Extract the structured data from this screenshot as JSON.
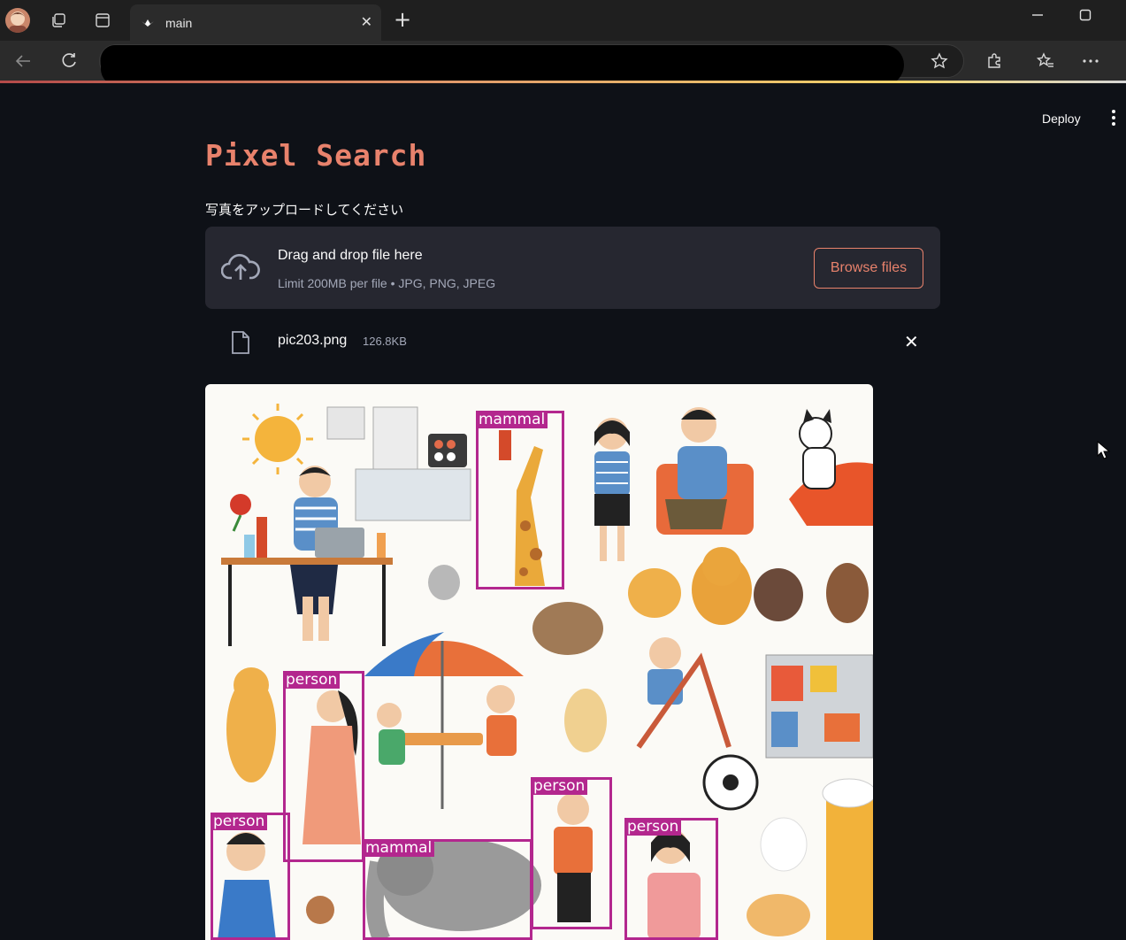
{
  "browser": {
    "tab_title": "main",
    "tab_close": "✕",
    "new_tab": "+"
  },
  "app": {
    "deploy_label": "Deploy",
    "title": "Pixel Search",
    "uploader_label": "写真をアップロードしてください",
    "dropzone_main": "Drag and drop file here",
    "dropzone_sub": "Limit 200MB per file • JPG, PNG, JPEG",
    "browse_label": "Browse files",
    "file_name": "pic203.png",
    "file_size": "126.8KB",
    "file_remove": "✕"
  },
  "detections": [
    {
      "label": "mammal"
    },
    {
      "label": "person"
    },
    {
      "label": "person"
    },
    {
      "label": "mammal"
    },
    {
      "label": "person"
    },
    {
      "label": "person"
    }
  ],
  "colors": {
    "accent": "#e8826c",
    "detection_box": "#b3278e",
    "background": "#0e1117",
    "dropzone": "#262730"
  }
}
